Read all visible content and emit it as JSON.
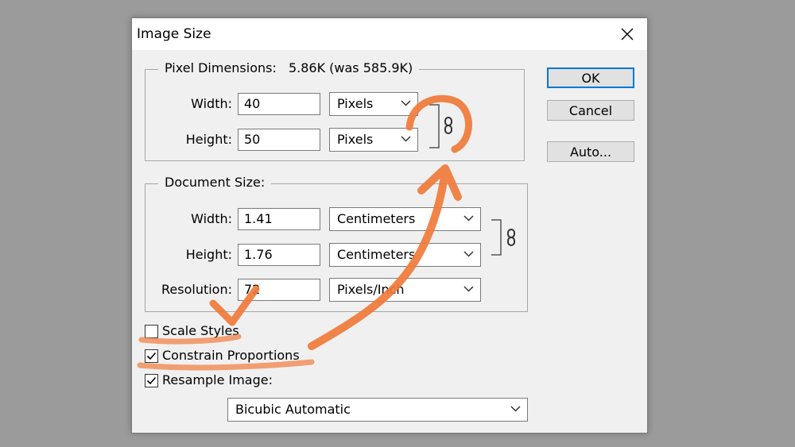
{
  "dialog": {
    "title": "Image Size"
  },
  "pixel_dimensions": {
    "label": "Pixel Dimensions:",
    "size_text": "5.86K (was 585.9K)",
    "width_label": "Width:",
    "width_value": "40",
    "width_unit": "Pixels",
    "height_label": "Height:",
    "height_value": "50",
    "height_unit": "Pixels"
  },
  "document_size": {
    "label": "Document Size:",
    "width_label": "Width:",
    "width_value": "1.41",
    "width_unit": "Centimeters",
    "height_label": "Height:",
    "height_value": "1.76",
    "height_unit": "Centimeters",
    "resolution_label": "Resolution:",
    "resolution_value": "72",
    "resolution_unit": "Pixels/Inch"
  },
  "options": {
    "scale_styles": {
      "label": "Scale Styles",
      "checked": false
    },
    "constrain_proportions": {
      "label": "Constrain Proportions",
      "checked": true
    },
    "resample_image": {
      "label": "Resample Image:",
      "checked": true
    },
    "resample_method": "Bicubic Automatic"
  },
  "buttons": {
    "ok": "OK",
    "cancel": "Cancel",
    "auto": "Auto..."
  },
  "colors": {
    "annotation": "#f07a3a",
    "default_button_border": "#0078d7",
    "dialog_bg": "#f0f0f0",
    "screen_bg": "#9b9b9b"
  },
  "icons": [
    "close-icon",
    "chain-link-icon",
    "chevron-down-icon",
    "checkmark-icon"
  ]
}
